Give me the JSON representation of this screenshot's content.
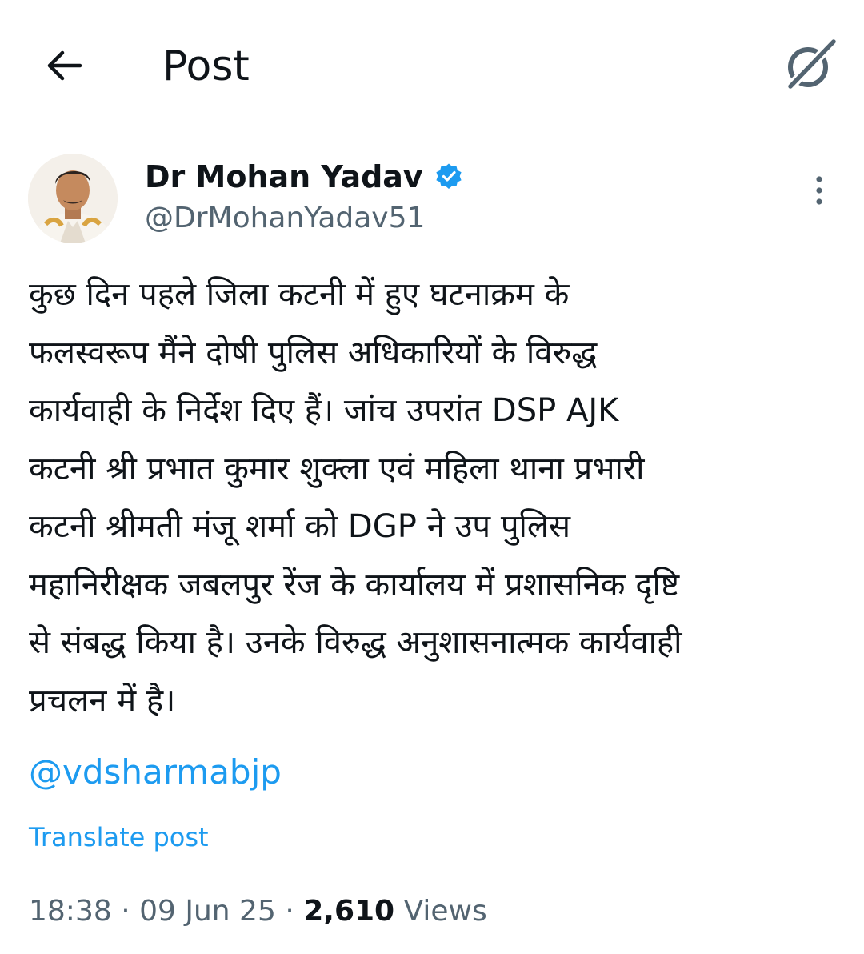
{
  "header": {
    "title": "Post",
    "back_icon": "arrow-left-icon",
    "grok_icon": "grok-icon"
  },
  "author": {
    "name": "Dr Mohan Yadav",
    "handle": "@DrMohanYadav51",
    "verified_icon": "verified-badge-icon",
    "verified_color": "#1d9bf0"
  },
  "post": {
    "text": "कुछ दिन पहले जिला कटनी में हुए घटनाक्रम के\nफलस्वरूप मैंने दोषी पुलिस अधिकारियों के विरुद्ध\nकार्यवाही के निर्देश दिए हैं। जांच उपरांत DSP AJK\nकटनी श्री प्रभात कुमार शुक्ला एवं महिला थाना प्रभारी\nकटनी श्रीमती मंजू शर्मा को DGP ने उप पुलिस\nमहानिरीक्षक जबलपुर रेंज के कार्यालय में प्रशासनिक दृष्टि\nसे संबद्ध किया है। उनके विरुद्ध अनुशासनात्मक कार्यवाही\nप्रचलन में है।",
    "mention": "@vdsharmabjp",
    "translate_label": "Translate post",
    "time": "18:38",
    "separator": "·",
    "date": "09 Jun 25",
    "views_count": "2,610",
    "views_label": "Views"
  },
  "colors": {
    "link": "#1d9bf0",
    "secondary_text": "#536471",
    "primary_text": "#0f1419",
    "divider": "#e6e9ec"
  }
}
